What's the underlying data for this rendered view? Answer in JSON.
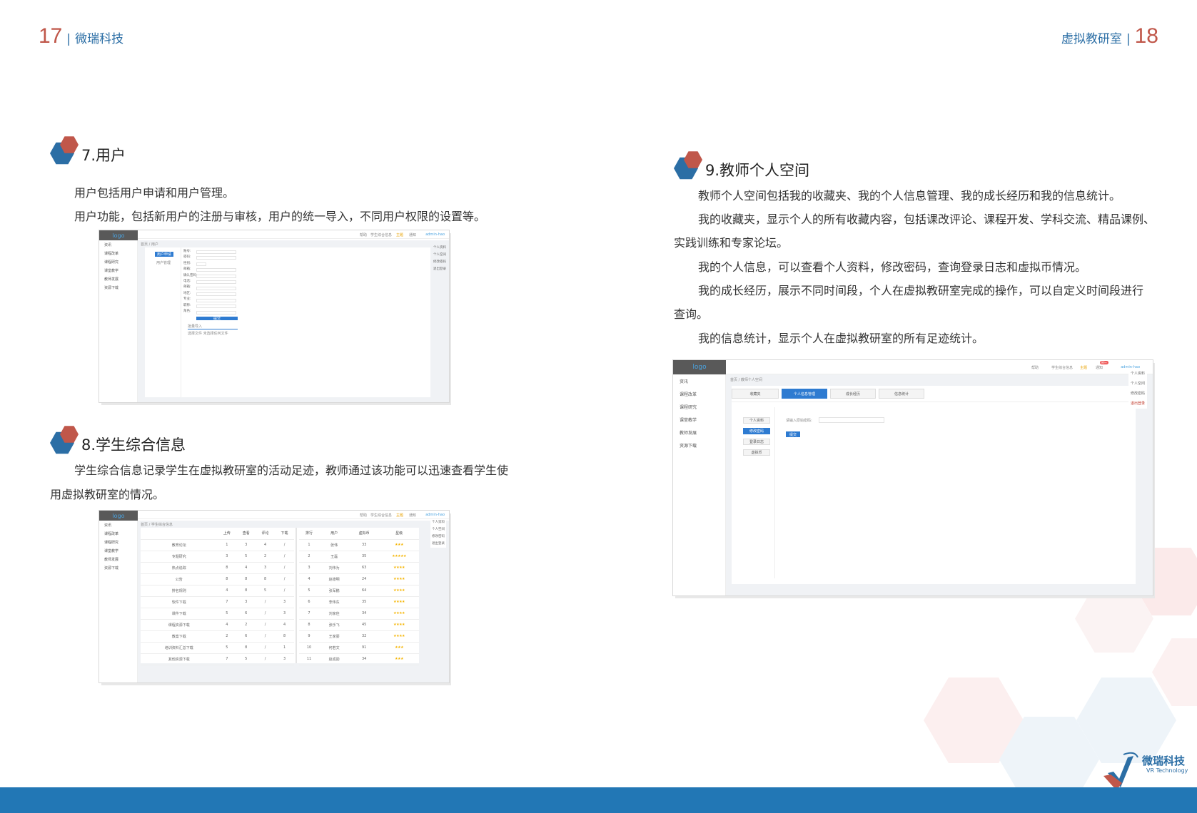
{
  "header": {
    "left_page": "17",
    "left_title": "微瑞科技",
    "right_title": "虚拟教研室",
    "right_page": "18",
    "sep": "|"
  },
  "sections": {
    "users": {
      "title": "7.用户",
      "p1": "用户包括用户申请和用户管理。",
      "p2": "用户功能，包括新用户的注册与审核，用户的统一导入，不同用户权限的设置等。"
    },
    "students": {
      "title": "8.学生综合信息",
      "p1": "学生综合信息记录学生在虚拟教研室的活动足迹，教师通过该功能可以迅速查看学生使",
      "p2": "用虚拟教研室的情况。"
    },
    "teacher": {
      "title": "9.教师个人空间",
      "p1": "教师个人空间包括我的收藏夹、我的个人信息管理、我的成长经历和我的信息统计。",
      "p2": "我的收藏夹，显示个人的所有收藏内容，包括课改评论、课程开发、学科交流、精品课例、",
      "p2b": "实践训练和专家论坛。",
      "p3": "我的个人信息，可以查看个人资料，修改密码，查询登录日志和虚拟币情况。",
      "p4": "我的成长经历，展示不同时间段，个人在虚拟教研室完成的操作，可以自定义时间段进行",
      "p4b": "查询。",
      "p5": "我的信息统计，显示个人在虚拟教研室的所有足迹统计。"
    }
  },
  "shots": {
    "logo": "logo",
    "sidebar": [
      "资讯",
      "课程改革",
      "课程研究",
      "课堂教学",
      "教师发展",
      "资源下载"
    ],
    "topbar": {
      "help": "帮助",
      "student_info": "学生综合信息",
      "theme": "主题",
      "notice": "通知",
      "user": "admin-hao",
      "badge": "99+"
    },
    "user_menu": [
      "个人资料",
      "个人空间",
      "修改密码",
      "退出登录"
    ],
    "users": {
      "breadcrumb": "首页 / 用户",
      "tab_apply": "用户申请",
      "tab_manage": "用户管理",
      "labels": [
        "账号:",
        "密码:",
        "性别:",
        "邮箱:",
        "确认密码:",
        "电话:",
        "邮箱:",
        "地区:",
        "专业:",
        "职称:",
        "角色:"
      ],
      "submit": "提交",
      "import": "批量导入",
      "import_note": "选择文件 未选择任何文件"
    },
    "students": {
      "breadcrumb": "首页 / 学生综合信息",
      "left_headers": [
        "",
        "上传",
        "查看",
        "评论",
        "下载"
      ],
      "left_rows": [
        [
          "教育论坛",
          "1",
          "3",
          "4",
          "/"
        ],
        [
          "专题研究",
          "3",
          "5",
          "2",
          "/"
        ],
        [
          "热点追踪",
          "8",
          "4",
          "3",
          "/"
        ],
        [
          "公告",
          "8",
          "8",
          "8",
          "/"
        ],
        [
          "排名规则",
          "4",
          "8",
          "5",
          "/"
        ],
        [
          "软件下载",
          "7",
          "3",
          "/",
          "3"
        ],
        [
          "课件下载",
          "5",
          "6",
          "/",
          "3"
        ],
        [
          "课程资源下载",
          "4",
          "2",
          "/",
          "4"
        ],
        [
          "教案下载",
          "2",
          "6",
          "/",
          "8"
        ],
        [
          "培训资料汇总下载",
          "5",
          "8",
          "/",
          "1"
        ],
        [
          "其他资源下载",
          "7",
          "5",
          "/",
          "3"
        ]
      ],
      "right_headers": [
        "排行",
        "用户",
        "虚拟币",
        "星级"
      ],
      "right_rows": [
        [
          "1",
          "张伟",
          "33",
          "★★★"
        ],
        [
          "2",
          "王磊",
          "35",
          "★★★★★"
        ],
        [
          "3",
          "刘伟为",
          "63",
          "★★★★"
        ],
        [
          "4",
          "赵德明",
          "24",
          "★★★★"
        ],
        [
          "5",
          "张军鹏",
          "64",
          "★★★★"
        ],
        [
          "6",
          "李伟东",
          "35",
          "★★★★"
        ],
        [
          "7",
          "刘家佳",
          "34",
          "★★★★"
        ],
        [
          "8",
          "张乐飞",
          "45",
          "★★★★"
        ],
        [
          "9",
          "王家豪",
          "32",
          "★★★★"
        ],
        [
          "10",
          "何若文",
          "91",
          "★★★"
        ],
        [
          "11",
          "赵成勋",
          "34",
          "★★★"
        ]
      ]
    },
    "teacher": {
      "breadcrumb": "首页 / 教师个人空间",
      "tabs": [
        "收藏夹",
        "个人信息管理",
        "成长经历",
        "信息统计"
      ],
      "left_menu": [
        "个人资料",
        "修改密码",
        "登录日志",
        "虚拟币"
      ],
      "field_label": "请输入原始密码:",
      "submit": "提交"
    }
  },
  "brand": {
    "name": "微瑞科技",
    "sub": "VR Technology"
  },
  "colors": {
    "accent_red": "#c0574a",
    "accent_blue": "#2b6ea5",
    "footer": "#2277b5"
  }
}
